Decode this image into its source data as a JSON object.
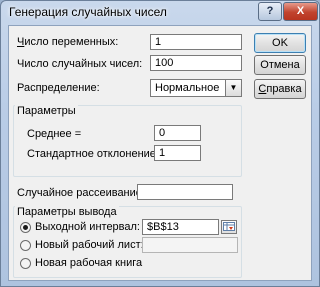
{
  "window": {
    "title": "Генерация случайных чисел",
    "help_button": "?",
    "close_button": "X"
  },
  "fields": {
    "variables_label": "Число переменных:",
    "variables_value": "1",
    "random_count_label": "Число случайных чисел:",
    "random_count_value": "100",
    "distribution_label": "Распределение:",
    "distribution_value": "Нормальное"
  },
  "buttons": {
    "ok": "OK",
    "cancel": "Отмена",
    "help": "Справка"
  },
  "parameters": {
    "title": "Параметры",
    "mean_label": "Среднее =",
    "mean_value": "0",
    "stddev_label": "Стандартное отклонение =",
    "stddev_value": "1"
  },
  "seed": {
    "label": "Случайное рассеивание:",
    "value": ""
  },
  "output": {
    "title": "Параметры вывода",
    "range_label": "Выходной интервал:",
    "range_value": "$B$13",
    "new_sheet_label": "Новый рабочий лист:",
    "new_sheet_value": "",
    "new_workbook_label": "Новая рабочая книга",
    "selected": "range"
  }
}
